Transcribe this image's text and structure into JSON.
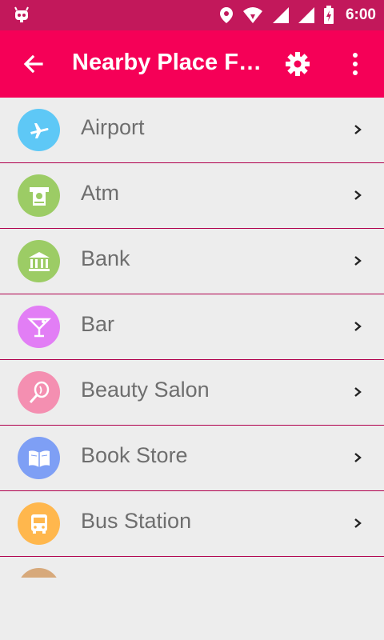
{
  "status_bar": {
    "time": "6:00",
    "icons": [
      "android-icon",
      "location-icon",
      "wifi-icon",
      "signal-icon",
      "signal-icon",
      "battery-charging-icon"
    ],
    "bg_color": "#c2185b"
  },
  "app_bar": {
    "title": "Nearby Place Fi…",
    "bg_color": "#f50057",
    "icons": [
      "back-arrow-icon",
      "settings-icon",
      "more-vert-icon"
    ]
  },
  "places": [
    {
      "label": "Airport",
      "icon": "airplane-icon",
      "color": "#5ec8f6"
    },
    {
      "label": "Atm",
      "icon": "atm-icon",
      "color": "#9ccc65"
    },
    {
      "label": "Bank",
      "icon": "bank-icon",
      "color": "#9ccc65"
    },
    {
      "label": "Bar",
      "icon": "cocktail-icon",
      "color": "#e27ef5"
    },
    {
      "label": "Beauty Salon",
      "icon": "mirror-icon",
      "color": "#f48fb1"
    },
    {
      "label": "Book Store",
      "icon": "book-icon",
      "color": "#7e9ff5"
    },
    {
      "label": "Bus Station",
      "icon": "bus-icon",
      "color": "#ffb74d"
    },
    {
      "label": "",
      "icon": "cafe-icon",
      "color": "#d7a97b"
    }
  ]
}
